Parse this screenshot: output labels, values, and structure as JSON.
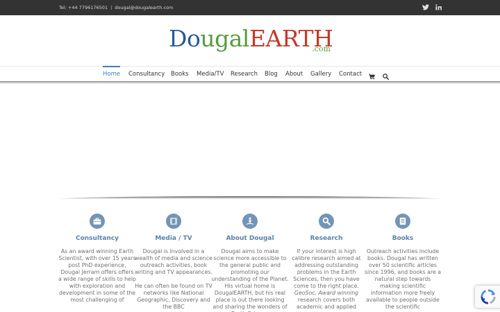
{
  "topbar": {
    "phone": "Tel: +44 7796176501",
    "separator": "|",
    "email": "dougal@dougalearth.com",
    "social": [
      "twitter-icon",
      "linkedin-icon"
    ]
  },
  "logo": {
    "part1": "D",
    "part1b": "o",
    "part2": "ugal",
    "part3": "EARTH",
    "suffix": ".com"
  },
  "nav": {
    "items": [
      {
        "label": "Home",
        "active": true
      },
      {
        "label": "Consultancy"
      },
      {
        "label": "Books"
      },
      {
        "label": "Media/TV"
      },
      {
        "label": "Research"
      },
      {
        "label": "Blog"
      },
      {
        "label": "About"
      },
      {
        "label": "Gallery"
      },
      {
        "label": "Contact"
      }
    ],
    "icons": [
      "cart-icon",
      "search-icon"
    ]
  },
  "features": [
    {
      "icon": "briefcase-icon",
      "title": "Consultancy",
      "text": "As an award winning Earth Scientist, with over 15 years post PhD experience, Dougal Jerram offers offers a wide range of skills to help with exploration and development in some of the most challenging of"
    },
    {
      "icon": "film-icon",
      "title": "Media / TV",
      "text": "Dougal is involved in a wealth of media and science outreach activities, book writing and TV appearances.",
      "text2": "He can often be found on TV networks like National Geographic, Discovery and the BBC"
    },
    {
      "icon": "person-icon",
      "title": "About Dougal",
      "text": "Dougal aims to make science more accessible to the general public and promoting our understanding of the Planet. His virtual home is DougalEARTH, but his real place is out there looking and sharing the wonders of Earth Science"
    },
    {
      "icon": "magnifier-icon",
      "title": "Research",
      "text": "If your interest is high calibre research aimed at addressing outstanding problems in the Earth Sciences, then you have come to the right place.",
      "text_em": "GeoSoc. Award winning",
      "text_after": " research covers both academic and applied"
    },
    {
      "icon": "book-icon",
      "title": "Books",
      "text": "Outreach activities include books. Dougal has written over 50 scientific articles since 1996, and books are a natural step towards making scientific information more freely available to people outside the scientific"
    }
  ],
  "colors": {
    "topbar_bg": "#333333",
    "accent": "#3b7fb8",
    "feature_circle": "#7394b5",
    "feature_title": "#5a82aa"
  }
}
